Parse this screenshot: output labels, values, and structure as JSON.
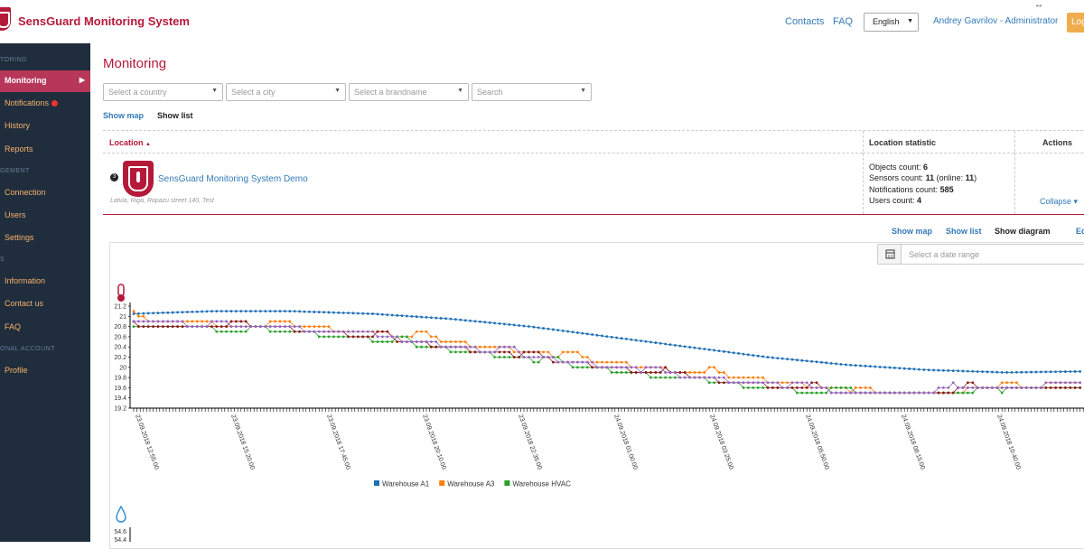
{
  "header": {
    "app_title": "SensGuard Monitoring System",
    "contacts": "Contacts",
    "faq": "FAQ",
    "language": "English",
    "user": "Andrey Gavrilov - Administrator",
    "logout": "Log",
    "resize_glyph": "↔"
  },
  "sidebar": {
    "sections": [
      "TORING",
      "GEMENT",
      "S",
      "ONAL ACCOUNT"
    ],
    "items": [
      {
        "label": "Monitoring",
        "active": true
      },
      {
        "label": "Notifications"
      },
      {
        "label": "History"
      },
      {
        "label": "Reports"
      },
      {
        "label": "Connection"
      },
      {
        "label": "Users"
      },
      {
        "label": "Settings"
      },
      {
        "label": "Information"
      },
      {
        "label": "Contact us"
      },
      {
        "label": "FAQ"
      },
      {
        "label": "Profile"
      }
    ]
  },
  "main": {
    "title": "Monitoring",
    "filters": {
      "country": "Select a country",
      "city": "Select a city",
      "brand": "Select a brandname",
      "search": "Search"
    },
    "view_tabs": {
      "show_map": "Show map",
      "show_list": "Show list"
    },
    "table": {
      "col_location": "Location",
      "col_location_sort": "▲",
      "col_stat": "Location statistic",
      "col_actions": "Actions",
      "row": {
        "badge": "3",
        "name": "SensGuard Monitoring System Demo",
        "address": "Latvia, Riga, Ropazu street 140, Test",
        "objects_label": "Objects count:",
        "objects_value": "6",
        "sensors_label": "Sensors count:",
        "sensors_value": "11",
        "online_label": "(online:",
        "online_value": "11",
        "online_close": ")",
        "notifications_label": "Notifications count:",
        "notifications_value": "585",
        "users_label": "Users count:",
        "users_value": "4",
        "collapse": "Collapse ▾"
      }
    },
    "detail_tabs": {
      "show_map": "Show map",
      "show_list": "Show list",
      "show_diagram": "Show diagram",
      "edit": "Ed"
    },
    "date_range_placeholder": "Select a date range"
  },
  "chart_data": {
    "type": "line",
    "y_ticks": [
      "21.2",
      "21",
      "20.8",
      "20.6",
      "20.4",
      "20.2",
      "20",
      "19.8",
      "19.6",
      "19.4",
      "19.2"
    ],
    "ylim": [
      19.2,
      21.2
    ],
    "x_ticks": [
      "23.09.2018 12:55:00",
      "23.09.2018 15:20:00",
      "23.09.2018 17:45:00",
      "23.09.2018 20:10:00",
      "23.09.2018 22:35:00",
      "24.09.2018 01:00:00",
      "24.09.2018 03:25:00",
      "24.09.2018 05:50:00",
      "24.09.2018 08:15:00",
      "24.09.2018 10:40:00"
    ],
    "series": [
      {
        "name": "Warehouse A1",
        "color": "#1f6fb5",
        "values": [
          21.05,
          21.1,
          21.1,
          21.05,
          20.95,
          20.8,
          20.6,
          20.4,
          20.2,
          20.05,
          19.95,
          19.9,
          19.92
        ]
      },
      {
        "name": "Warehouse A3",
        "color": "#ff7f0e",
        "values": [
          20.95,
          20.85,
          20.8,
          20.7,
          20.5,
          20.3,
          20.1,
          19.9,
          19.75,
          19.55,
          19.5,
          19.6,
          19.7
        ]
      },
      {
        "name": "Warehouse HVAC",
        "color": "#2ca02c",
        "values": [
          20.8,
          20.75,
          20.7,
          20.55,
          20.35,
          20.15,
          19.95,
          19.75,
          19.6,
          19.45,
          19.45,
          19.55,
          19.62
        ]
      },
      {
        "name": "",
        "color": "#8b1a1a",
        "values": [
          20.85,
          20.8,
          20.75,
          20.6,
          20.4,
          20.2,
          20.0,
          19.8,
          19.65,
          19.5,
          19.5,
          19.6,
          19.65
        ]
      },
      {
        "name": "",
        "color": "#9467bd",
        "values": [
          20.9,
          20.82,
          20.77,
          20.62,
          20.42,
          20.22,
          20.02,
          19.82,
          19.67,
          19.52,
          19.52,
          19.62,
          19.68
        ]
      }
    ],
    "humidity_ticks": [
      "54.6",
      "54.4"
    ]
  }
}
